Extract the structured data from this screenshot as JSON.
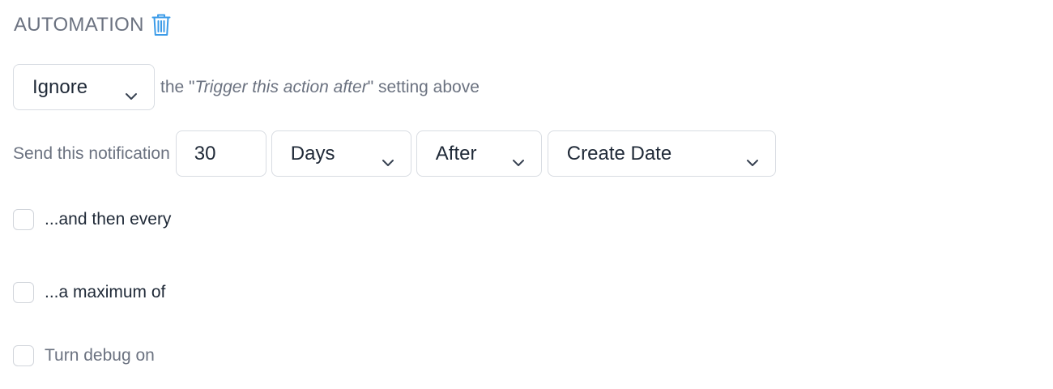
{
  "section": {
    "title": "AUTOMATION",
    "delete_icon": "trash-icon",
    "accent_color": "#3b9be8"
  },
  "mode": {
    "selected": "Ignore",
    "prefix": "the \"",
    "setting_name": "Trigger this action after",
    "suffix": "\" setting above"
  },
  "send": {
    "label": "Send this notification",
    "amount": "30",
    "unit": "Days",
    "direction": "After",
    "date_field": "Create Date"
  },
  "options": {
    "repeat_label": "...and then every",
    "repeat_checked": false,
    "max_label": "...a maximum of",
    "max_checked": false,
    "debug_label": "Turn debug on",
    "debug_checked": false
  }
}
